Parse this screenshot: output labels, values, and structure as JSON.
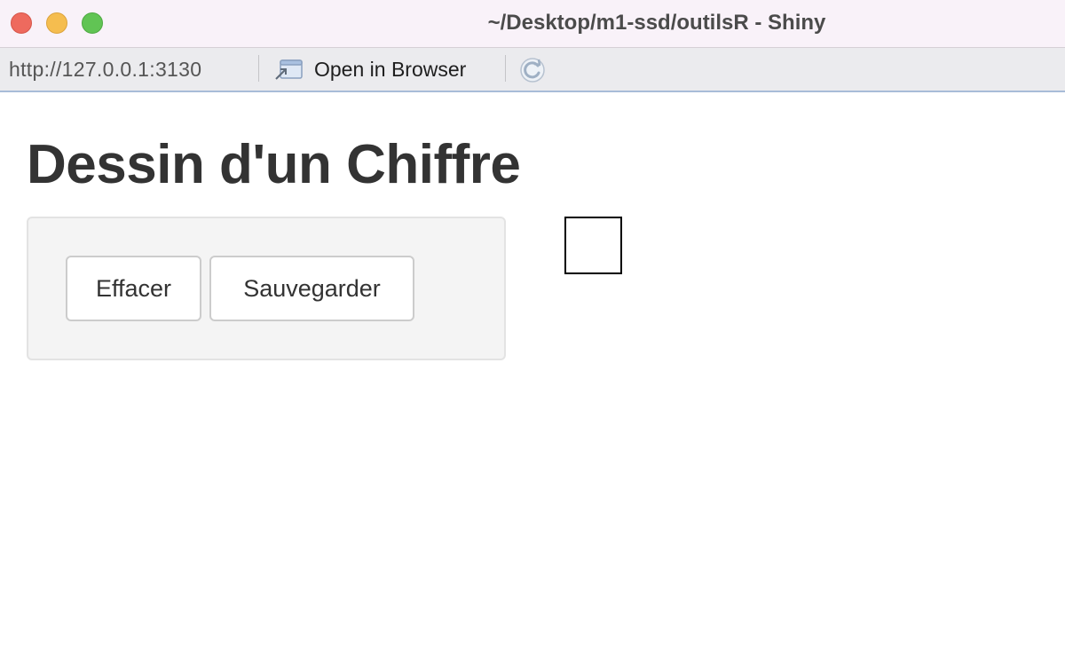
{
  "window": {
    "title": "~/Desktop/m1-ssd/outilsR - Shiny"
  },
  "toolbar": {
    "url": "http://127.0.0.1:3130",
    "open_in_browser_label": "Open in Browser",
    "open_icon": "open-in-browser-icon",
    "refresh_icon": "refresh-icon"
  },
  "page": {
    "title": "Dessin d'un Chiffre",
    "buttons": {
      "clear_label": "Effacer",
      "save_label": "Sauvegarder"
    }
  },
  "colors": {
    "close": "#ee6a5e",
    "minimize": "#f5bd4f",
    "maximize": "#61c454",
    "title_text": "#333333",
    "panel_bg": "#f4f4f4"
  }
}
